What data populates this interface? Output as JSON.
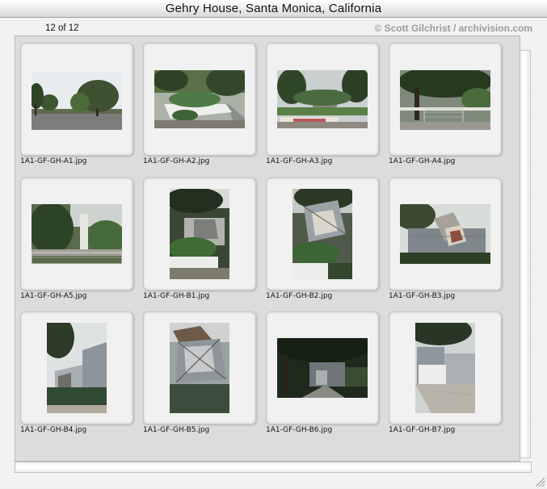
{
  "window": {
    "title": "Gehry House, Santa Monica, California"
  },
  "header": {
    "counter": "12 of 12",
    "credit": "© Scott Gilchrist / archivision.com"
  },
  "thumbnails": [
    {
      "filename": "1A1-GF-GH-A1.jpg",
      "orientation": "landscape",
      "scene": "tree-lined suburban street corner"
    },
    {
      "filename": "1A1-GF-GH-A2.jpg",
      "orientation": "landscape",
      "scene": "white planter garden beside sidewalk"
    },
    {
      "filename": "1A1-GF-GH-A3.jpg",
      "orientation": "landscape",
      "scene": "garden and lawn in front of house"
    },
    {
      "filename": "1A1-GF-GH-A4.jpg",
      "orientation": "landscape",
      "scene": "chain link fence under large tree"
    },
    {
      "filename": "1A1-GF-GH-A5.jpg",
      "orientation": "landscape",
      "scene": "shrubs behind chain link fence"
    },
    {
      "filename": "1A1-GF-GH-B1.jpg",
      "orientation": "portrait",
      "scene": "house facade with planter"
    },
    {
      "filename": "1A1-GF-GH-B2.jpg",
      "orientation": "portrait",
      "scene": "angled glass window corner"
    },
    {
      "filename": "1A1-GF-GH-B3.jpg",
      "orientation": "landscape",
      "scene": "corrugated metal facade with tilted glass cube"
    },
    {
      "filename": "1A1-GF-GH-B4.jpg",
      "orientation": "portrait",
      "scene": "corrugated metal wall with agave plants"
    },
    {
      "filename": "1A1-GF-GH-B5.jpg",
      "orientation": "portrait",
      "scene": "wooden frame and glass structure"
    },
    {
      "filename": "1A1-GF-GH-B6.jpg",
      "orientation": "landscape",
      "scene": "driveway under dark trees"
    },
    {
      "filename": "1A1-GF-GH-B7.jpg",
      "orientation": "portrait",
      "scene": "white wall and concrete driveway"
    }
  ],
  "colors": {
    "title_text": "#111111",
    "credit_text": "#9b9b9b",
    "grid_background": "#dcdcdc",
    "card_background": "#f1f1f1"
  }
}
